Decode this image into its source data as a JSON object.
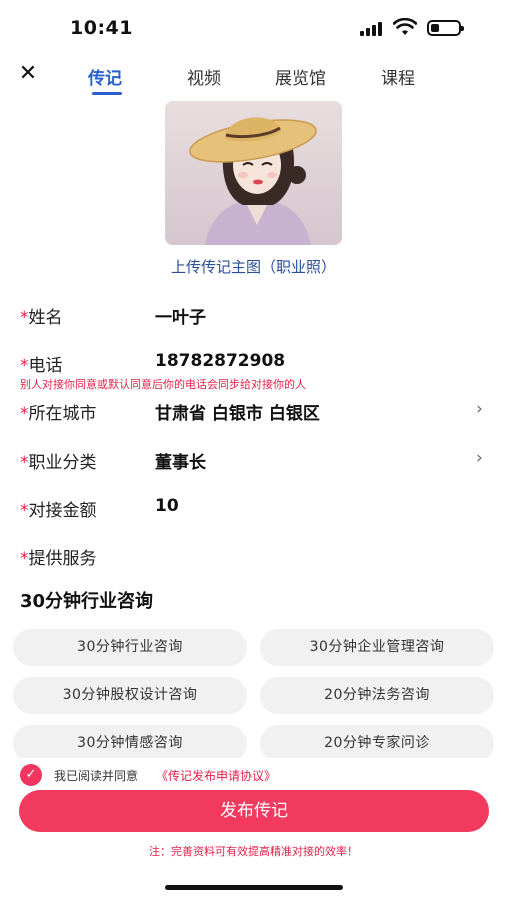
{
  "status_bar": {
    "time": "10:41"
  },
  "nav": {
    "close_icon": "close-icon",
    "tabs": [
      {
        "label": "传记",
        "active": true
      },
      {
        "label": "视频",
        "active": false
      },
      {
        "label": "展览馆",
        "active": false
      },
      {
        "label": "课程",
        "active": false
      }
    ]
  },
  "profile": {
    "upload_label": "上传传记主图（职业照）"
  },
  "form": {
    "required_mark": "*",
    "name": {
      "label": "姓名",
      "value": "一叶子"
    },
    "phone": {
      "label": "电话",
      "value": "18782872908",
      "note": "别人对接你同意或默认同意后你的电话会同步给对接你的人"
    },
    "city": {
      "label": "所在城市",
      "value": "甘肃省 白银市 白银区"
    },
    "occupation": {
      "label": "职业分类",
      "value": "董事长"
    },
    "amount": {
      "label": "对接金额",
      "value": "10"
    },
    "services": {
      "label": "提供服务",
      "selected": "30分钟行业咨询"
    }
  },
  "service_options": [
    "30分钟行业咨询",
    "30分钟企业管理咨询",
    "30分钟股权设计咨询",
    "20分钟法务咨询",
    "30分钟情感咨询",
    "20分钟专家问诊"
  ],
  "agreement": {
    "prefix": "我已阅读并同意",
    "link": "《传记发布申请协议》",
    "checked": true
  },
  "publish_button": "发布传记",
  "footer_note": "注：完善资料可有效提高精准对接的效率！",
  "colors": {
    "accent": "#2b5fcf",
    "primary": "#f23a5e",
    "warning": "#e0224a"
  }
}
